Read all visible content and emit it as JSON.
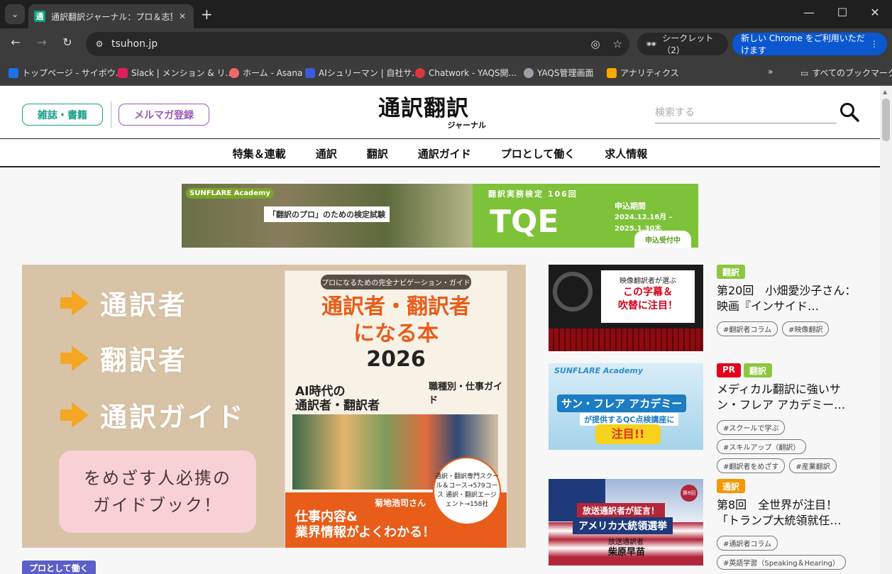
{
  "browser": {
    "tab_title": "通訳翻訳ジャーナル：プロ＆志望者",
    "favicon_char": "通",
    "url": "tsuhon.jp",
    "incognito_label": "シークレット（2）",
    "update_label": "新しい Chrome をご利用いただけます",
    "bookmarks": [
      {
        "label": "トップページ - サイボウ...",
        "color": "#1a73e8"
      },
      {
        "label": "Slack | メンション & リ...",
        "color": "#e01e5a"
      },
      {
        "label": "ホーム - Asana",
        "color": "#f06a6a"
      },
      {
        "label": "AIシュリーマン | 自社サ...",
        "color": "#3b5bdb"
      },
      {
        "label": "Chatwork - YAQS開...",
        "color": "#d9363e"
      },
      {
        "label": "YAQS管理画面",
        "color": "#9aa0a6"
      },
      {
        "label": "アナリティクス",
        "color": "#f9ab00"
      }
    ],
    "all_bookmarks": "すべてのブックマーク"
  },
  "header": {
    "magazine_btn": "雑誌・書籍",
    "newsletter_btn": "メルマガ登録",
    "logo_main": "通訳翻訳",
    "logo_sub": "ジャーナル",
    "search_placeholder": "検索する"
  },
  "nav": [
    "特集＆連載",
    "通訳",
    "翻訳",
    "通訳ガイド",
    "プロとして働く",
    "求人情報"
  ],
  "banner": {
    "brand": "SUNFLARE Academy",
    "tagline": "「翻訳のプロ」のための検定試験",
    "exam_label": "翻訳実務検定 106回",
    "logo": "TQE",
    "period_label": "申込期間",
    "period": "2024.12.16月 – 2025.1.30木",
    "apply": "申込受付中"
  },
  "hero": {
    "words": [
      "通訳者",
      "翻訳者",
      "通訳ガイド"
    ],
    "pink_line1": "をめざす人必携の",
    "pink_line2": "ガイドブック！",
    "book_top": "プロになるための完全ナビゲーション・ガイド",
    "book_title1": "通訳者・翻訳者",
    "book_title2": "になる本",
    "book_year": "2026",
    "book_ai1": "AI時代の",
    "book_ai2": "通訳者・翻訳者",
    "book_guide": "職種別・仕事ガイド",
    "book_bottom1": "仕事内容&",
    "book_bottom2": "業界情報がよくわかる！",
    "book_interview": "菊地浩司さん",
    "book_badge": "通訳・翻訳専門スクール＆コース→579コース 通訳・翻訳エージェント→158社",
    "bottom_category": "プロとして働く"
  },
  "cards": [
    {
      "labels": [
        {
          "text": "翻訳",
          "color": "#8dc63f"
        }
      ],
      "title": "第20回　小畑愛沙子さん：映画『インサイド…",
      "tags": [
        "#翻訳者コラム",
        "#映像翻訳"
      ],
      "thumb_t1": "映像翻訳者が選ぶ",
      "thumb_t2a": "この字幕＆",
      "thumb_t2b": "吹替に注目！"
    },
    {
      "labels": [
        {
          "text": "PR",
          "color": "#e3001b"
        },
        {
          "text": "翻訳",
          "color": "#8dc63f"
        }
      ],
      "title": "メディカル翻訳に強いサン・フレア アカデミー…",
      "tags": [
        "#スクールで学ぶ",
        "#スキルアップ（翻訳）",
        "#翻訳者をめざす",
        "#産業翻訳"
      ],
      "thumb_t1": "SUNFLARE Academy",
      "thumb_t2": "サン・フレア アカデミー",
      "thumb_t3": "が提供するQC点検講座に",
      "thumb_t4": "注目!!"
    },
    {
      "labels": [
        {
          "text": "通訳",
          "color": "#f39800"
        }
      ],
      "title": "第8回　全世界が注目！「トランプ大統領就任…",
      "tags": [
        "#通訳者コラム",
        "#英語学習（Speaking＆Hearing）"
      ],
      "thumb_t1": "放送通訳者が証言！",
      "thumb_t2": "アメリカ大統領選挙",
      "thumb_t3": "放送通訳者",
      "thumb_t4": "柴原早苗",
      "thumb_badge": "第8回"
    }
  ]
}
